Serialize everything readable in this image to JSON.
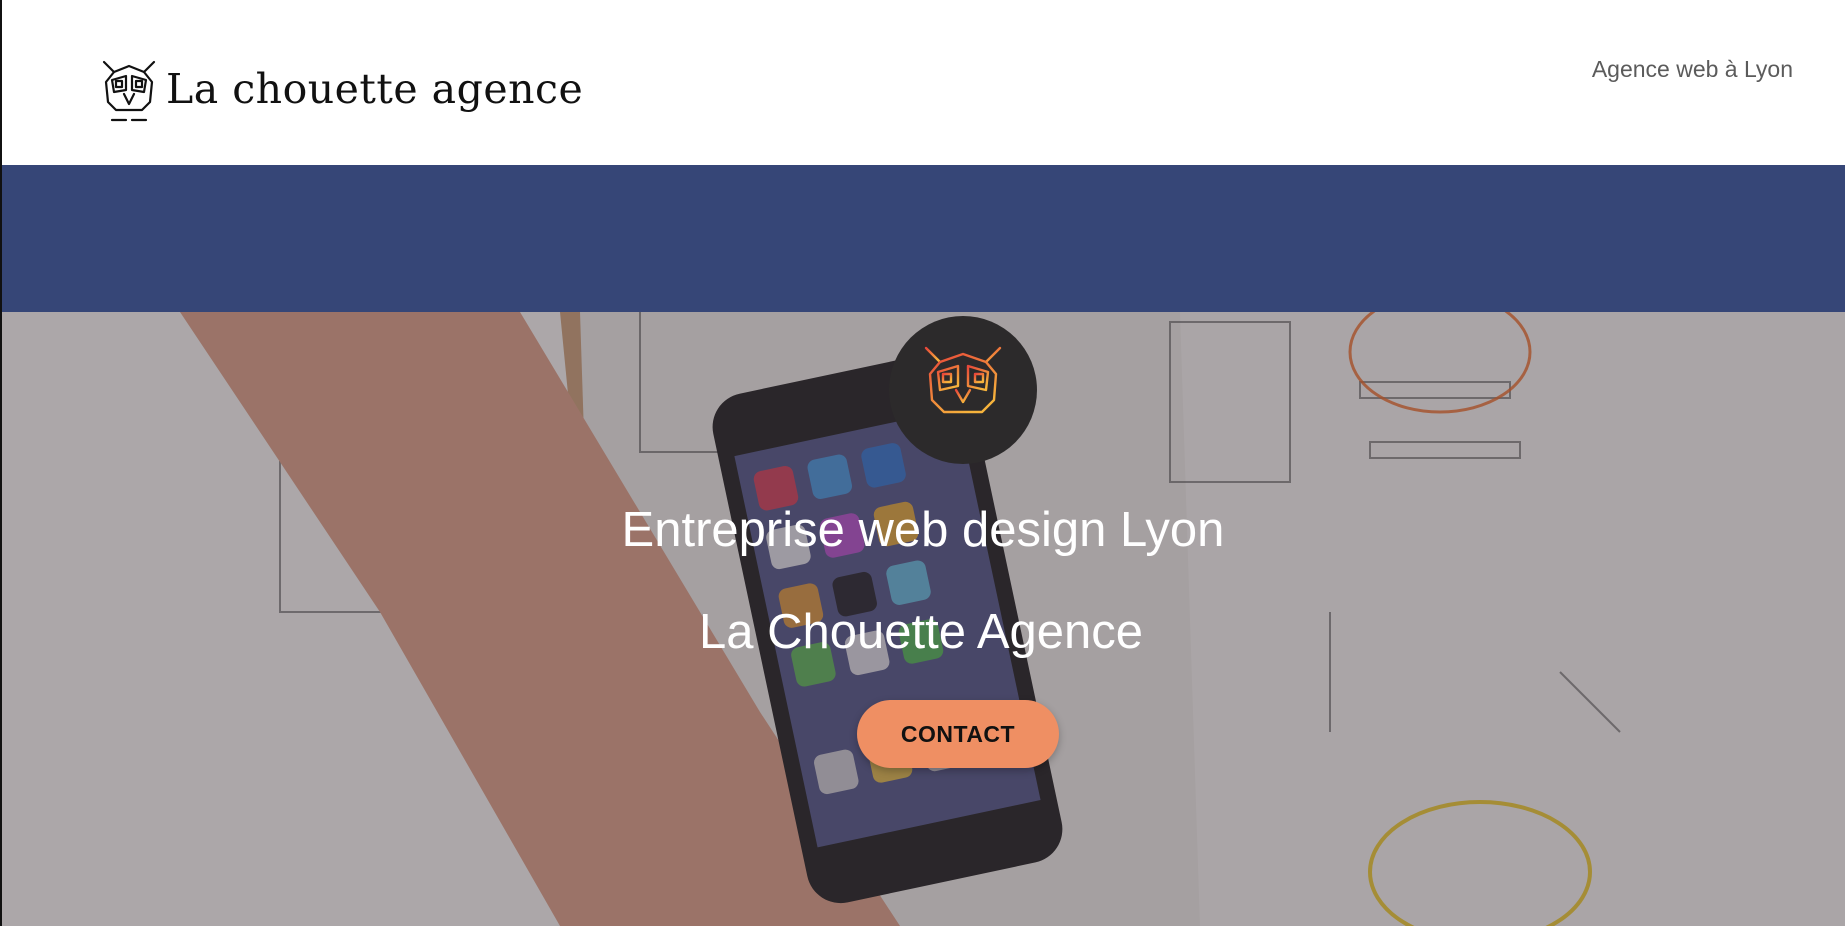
{
  "header": {
    "brand_name": "La chouette agence",
    "nav_link": "Agence web à Lyon"
  },
  "hero": {
    "title": "Entreprise web design Lyon",
    "subtitle": "La Chouette Agence",
    "cta_label": "CONTACT",
    "badge_icon": "owl-logo-icon"
  },
  "colors": {
    "band": "#364677",
    "cta": "#ef8f63",
    "badge": "#2c2a2b",
    "nav_text": "#5b5b5b"
  }
}
